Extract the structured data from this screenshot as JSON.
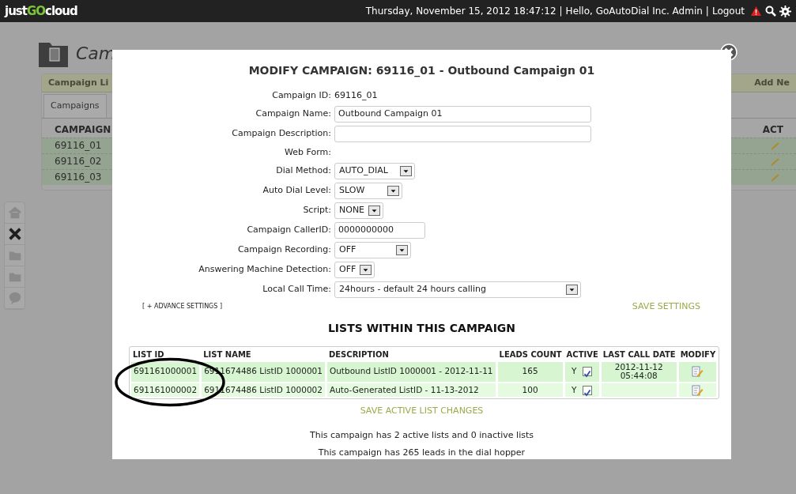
{
  "top_bar": {
    "logo": {
      "prefix": "just",
      "highlight": "GO",
      "suffix": "cloud"
    },
    "datetime": "Thursday, November 15, 2012 18:47:12",
    "separators": [
      "|",
      "|"
    ],
    "greeting": "Hello, GoAutoDial Inc. Admin",
    "logout": "Logout"
  },
  "background": {
    "page_title": "Cam",
    "card_header_left": "Campaign Li",
    "card_header_right": "Add Ne",
    "tabs": [
      {
        "label": "Campaigns",
        "selected": true
      }
    ],
    "columns": [
      "CAMPAIGN",
      "ACT"
    ],
    "rows": [
      {
        "campaign": "69116_01"
      },
      {
        "campaign": "69116_02"
      },
      {
        "campaign": "69116_03"
      }
    ],
    "sidebar": [
      {
        "kind": "home",
        "selected": false
      },
      {
        "kind": "tools",
        "selected": true
      },
      {
        "kind": "folder",
        "selected": false
      },
      {
        "kind": "folder",
        "selected": false
      },
      {
        "kind": "help",
        "selected": false
      }
    ]
  },
  "modal": {
    "title": "MODIFY CAMPAIGN: 69116_01 - Outbound Campaign 01",
    "fields": [
      {
        "label": "Campaign ID:",
        "kind": "text",
        "value": "69116_01"
      },
      {
        "label": "Campaign Name:",
        "kind": "input",
        "value": "Outbound Campaign 01"
      },
      {
        "label": "Campaign Description:",
        "kind": "input"
      },
      {
        "label": "Web Form:",
        "kind": "text"
      },
      {
        "label": "Dial Method:",
        "kind": "select",
        "value": "AUTO_DIAL"
      },
      {
        "label": "Auto Dial Level:",
        "kind": "select",
        "value": "SLOW"
      },
      {
        "label": "Script:",
        "kind": "select",
        "value": "NONE"
      },
      {
        "label": "Campaign CallerID:",
        "kind": "input",
        "value": "0000000000"
      },
      {
        "label": "Campaign Recording:",
        "kind": "select",
        "value": "OFF"
      },
      {
        "label": "Answering Machine Detection:",
        "kind": "select",
        "value": "OFF"
      },
      {
        "label": "Local Call Time:",
        "kind": "select",
        "value": "24hours - default 24 hours calling"
      }
    ],
    "advance_link": "[ + ADVANCE SETTINGS ]",
    "save_settings": "SAVE SETTINGS",
    "lists_heading": "LISTS WITHIN THIS CAMPAIGN",
    "list_columns": [
      "LIST ID",
      "LIST NAME",
      "DESCRIPTION",
      "LEADS COUNT",
      "ACTIVE",
      "LAST CALL DATE",
      "MODIFY"
    ],
    "lists": [
      {
        "list_id": "691161000001",
        "list_name": "6911674486 ListID 1000001",
        "description": "Outbound ListID 1000001 - 2012-11-11",
        "leads_count": "165",
        "active_flag": "Y",
        "active": true,
        "last_call_date": "2012-11-12 05:44:08"
      },
      {
        "list_id": "691161000002",
        "list_name": "6911674486 ListID 1000002",
        "description": "Auto-Generated ListID - 11-13-2012",
        "leads_count": "100",
        "active_flag": "Y",
        "active": true
      }
    ],
    "save_lists": "SAVE ACTIVE LIST CHANGES",
    "summary": [
      "This campaign has 2 active lists and 0 inactive lists",
      "This campaign has 265 leads in the dial hopper"
    ]
  }
}
